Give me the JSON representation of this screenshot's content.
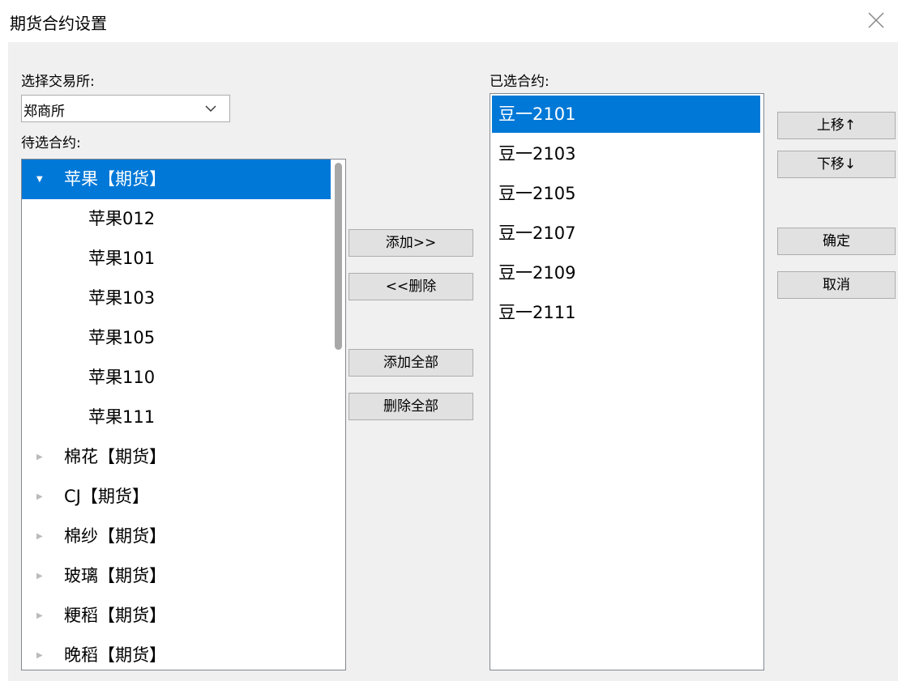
{
  "window": {
    "title": "期货合约设置",
    "close_icon": "close-icon"
  },
  "left": {
    "exchange_label": "选择交易所:",
    "exchange_selected": "郑商所",
    "candidates_label": "待选合约:",
    "tree": [
      {
        "label": "苹果【期货】",
        "level": 0,
        "expanded": true,
        "selected": true
      },
      {
        "label": "苹果012",
        "level": 1
      },
      {
        "label": "苹果101",
        "level": 1
      },
      {
        "label": "苹果103",
        "level": 1
      },
      {
        "label": "苹果105",
        "level": 1
      },
      {
        "label": "苹果110",
        "level": 1
      },
      {
        "label": "苹果111",
        "level": 1
      },
      {
        "label": "棉花【期货】",
        "level": 0
      },
      {
        "label": "CJ【期货】",
        "level": 0
      },
      {
        "label": "棉纱【期货】",
        "level": 0
      },
      {
        "label": "玻璃【期货】",
        "level": 0
      },
      {
        "label": "粳稻【期货】",
        "level": 0
      },
      {
        "label": "晚稻【期货】",
        "level": 0
      }
    ]
  },
  "middle": {
    "add": "添加>>",
    "remove": "<<删除",
    "add_all": "添加全部",
    "remove_all": "删除全部"
  },
  "right": {
    "selected_label": "已选合约:",
    "selected": [
      "豆一2101",
      "豆一2103",
      "豆一2105",
      "豆一2107",
      "豆一2109",
      "豆一2111"
    ],
    "selected_index": 0
  },
  "actions": {
    "move_up": "上移↑",
    "move_down": "下移↓",
    "ok": "确定",
    "cancel": "取消"
  },
  "colors": {
    "selection": "#0078d7",
    "panel_bg": "#f0f0f0"
  }
}
